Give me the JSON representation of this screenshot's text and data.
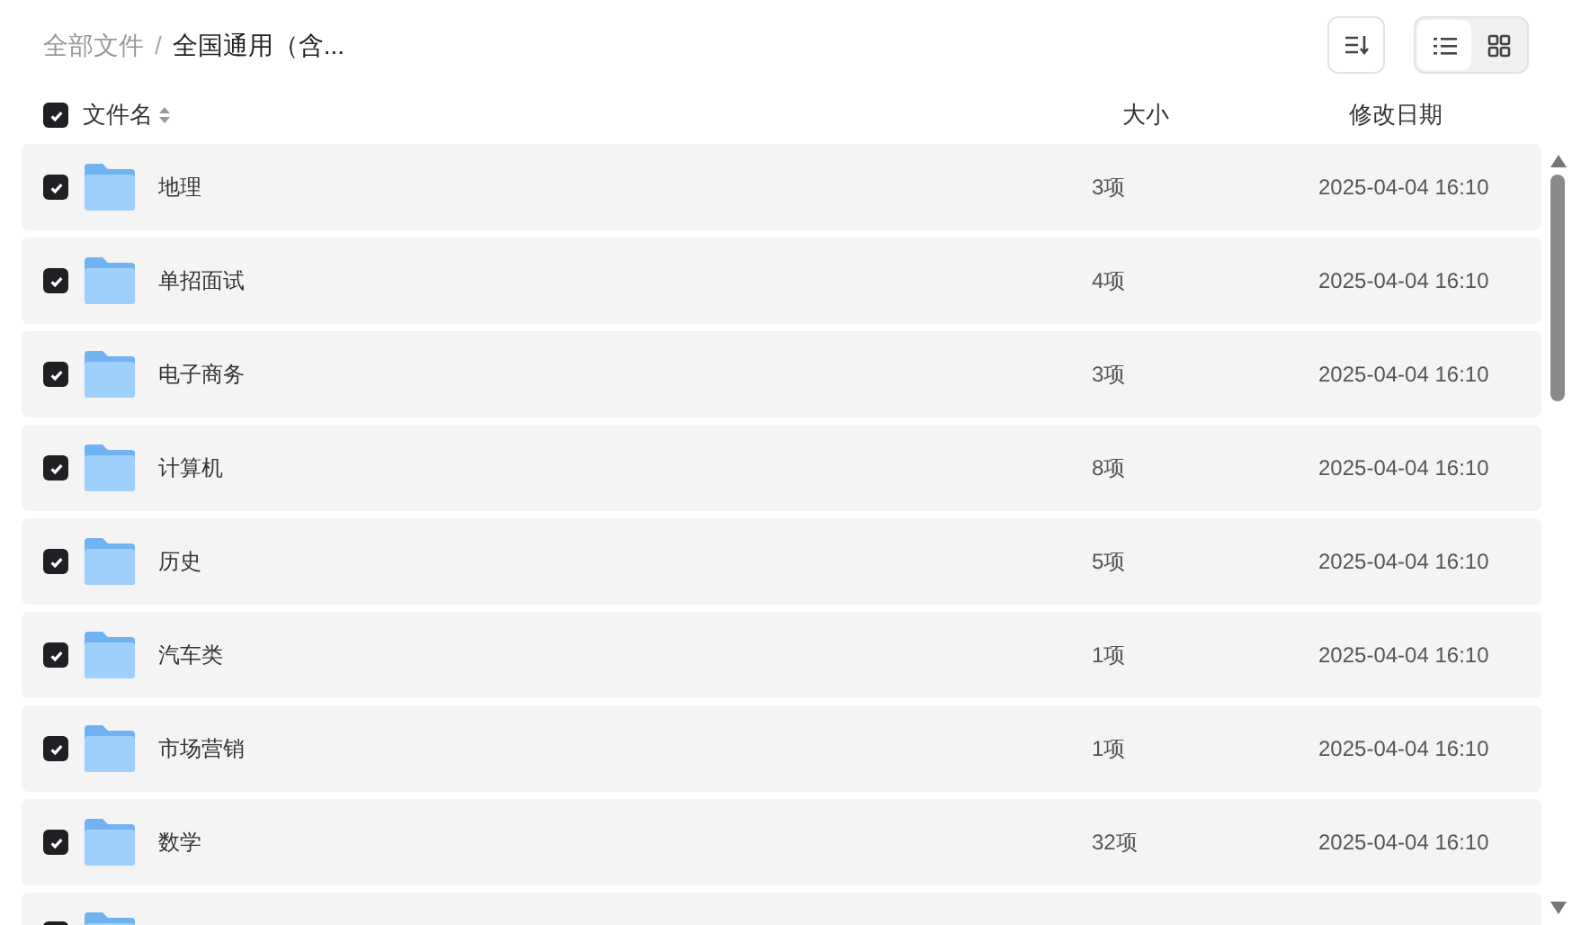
{
  "breadcrumb": [
    {
      "label": "全部文件",
      "current": false
    },
    {
      "label": "全国通用（含...",
      "current": true,
      "separator": "/"
    }
  ],
  "view_modes": [
    {
      "kind": "list",
      "selected": true
    },
    {
      "kind": "grid",
      "selected": false
    }
  ],
  "header": {
    "checked": true,
    "columns": [
      "文件名",
      "大小",
      "修改日期"
    ]
  },
  "rows": [
    {
      "name": "地理",
      "size": "3项",
      "date": "2025-04-04 16:10",
      "checked": true
    },
    {
      "name": "单招面试",
      "size": "4项",
      "date": "2025-04-04 16:10",
      "checked": true
    },
    {
      "name": "电子商务",
      "size": "3项",
      "date": "2025-04-04 16:10",
      "checked": true
    },
    {
      "name": "计算机",
      "size": "8项",
      "date": "2025-04-04 16:10",
      "checked": true
    },
    {
      "name": "历史",
      "size": "5项",
      "date": "2025-04-04 16:10",
      "checked": true
    },
    {
      "name": "汽车类",
      "size": "1项",
      "date": "2025-04-04 16:10",
      "checked": true
    },
    {
      "name": "市场营销",
      "size": "1项",
      "date": "2025-04-04 16:10",
      "checked": true
    },
    {
      "name": "数学",
      "size": "32项",
      "date": "2025-04-04 16:10",
      "checked": true
    }
  ],
  "partial_row": {
    "checked": true
  }
}
